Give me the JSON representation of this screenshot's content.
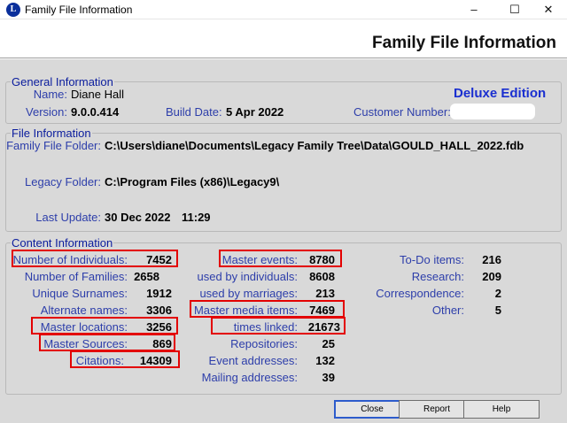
{
  "window": {
    "title": "Family File Information",
    "icon_letter": "L"
  },
  "header": {
    "title": "Family File Information"
  },
  "general": {
    "title": "General Information",
    "name_label": "Name:",
    "name_value": "Diane Hall",
    "edition": "Deluxe Edition",
    "version_label": "Version:",
    "version_value": "9.0.0.414",
    "build_label": "Build Date:",
    "build_value": "5 Apr 2022",
    "customer_label": "Customer Number:"
  },
  "file": {
    "title": "File Information",
    "folder_label": "Family File Folder:",
    "folder_value": "C:\\Users\\diane\\Documents\\Legacy Family Tree\\Data\\GOULD_HALL_2022.fdb",
    "legacy_label": "Legacy Folder:",
    "legacy_value": "C:\\Program Files (x86)\\Legacy9\\",
    "update_label": "Last Update:",
    "update_date": "30 Dec 2022",
    "update_time": "11:29"
  },
  "content": {
    "title": "Content Information",
    "col1": [
      {
        "label": "Number of Individuals:",
        "value": "7452"
      },
      {
        "label": "Number of Families:",
        "value": "2658"
      },
      {
        "label": "Unique Surnames:",
        "value": "1912"
      },
      {
        "label": "Alternate names:",
        "value": "3306"
      },
      {
        "label": "Master locations:",
        "value": "3256"
      },
      {
        "label": "Master Sources:",
        "value": "869"
      },
      {
        "label": "Citations:",
        "value": "14309"
      }
    ],
    "col2": [
      {
        "label": "Master events:",
        "value": "8780"
      },
      {
        "label": "used by individuals:",
        "value": "8608"
      },
      {
        "label": "used by marriages:",
        "value": "213"
      },
      {
        "label": "Master media items:",
        "value": "7469"
      },
      {
        "label": "times linked:",
        "value": "21673"
      },
      {
        "label": "Repositories:",
        "value": "25"
      },
      {
        "label": "Event addresses:",
        "value": "132"
      },
      {
        "label": "Mailing addresses:",
        "value": "39"
      }
    ],
    "col3": [
      {
        "label": "To-Do items:",
        "value": "216"
      },
      {
        "label": "Research:",
        "value": "209"
      },
      {
        "label": "Correspondence:",
        "value": "2"
      },
      {
        "label": "Other:",
        "value": "5"
      }
    ]
  },
  "buttons": {
    "close": "Close",
    "report": "Report",
    "help": "Help"
  },
  "colors": {
    "highlight": "#e30000",
    "label_blue": "#2d3eaa",
    "section_blue": "#0a1c9d",
    "dialog_bg": "#d9d9d9"
  }
}
